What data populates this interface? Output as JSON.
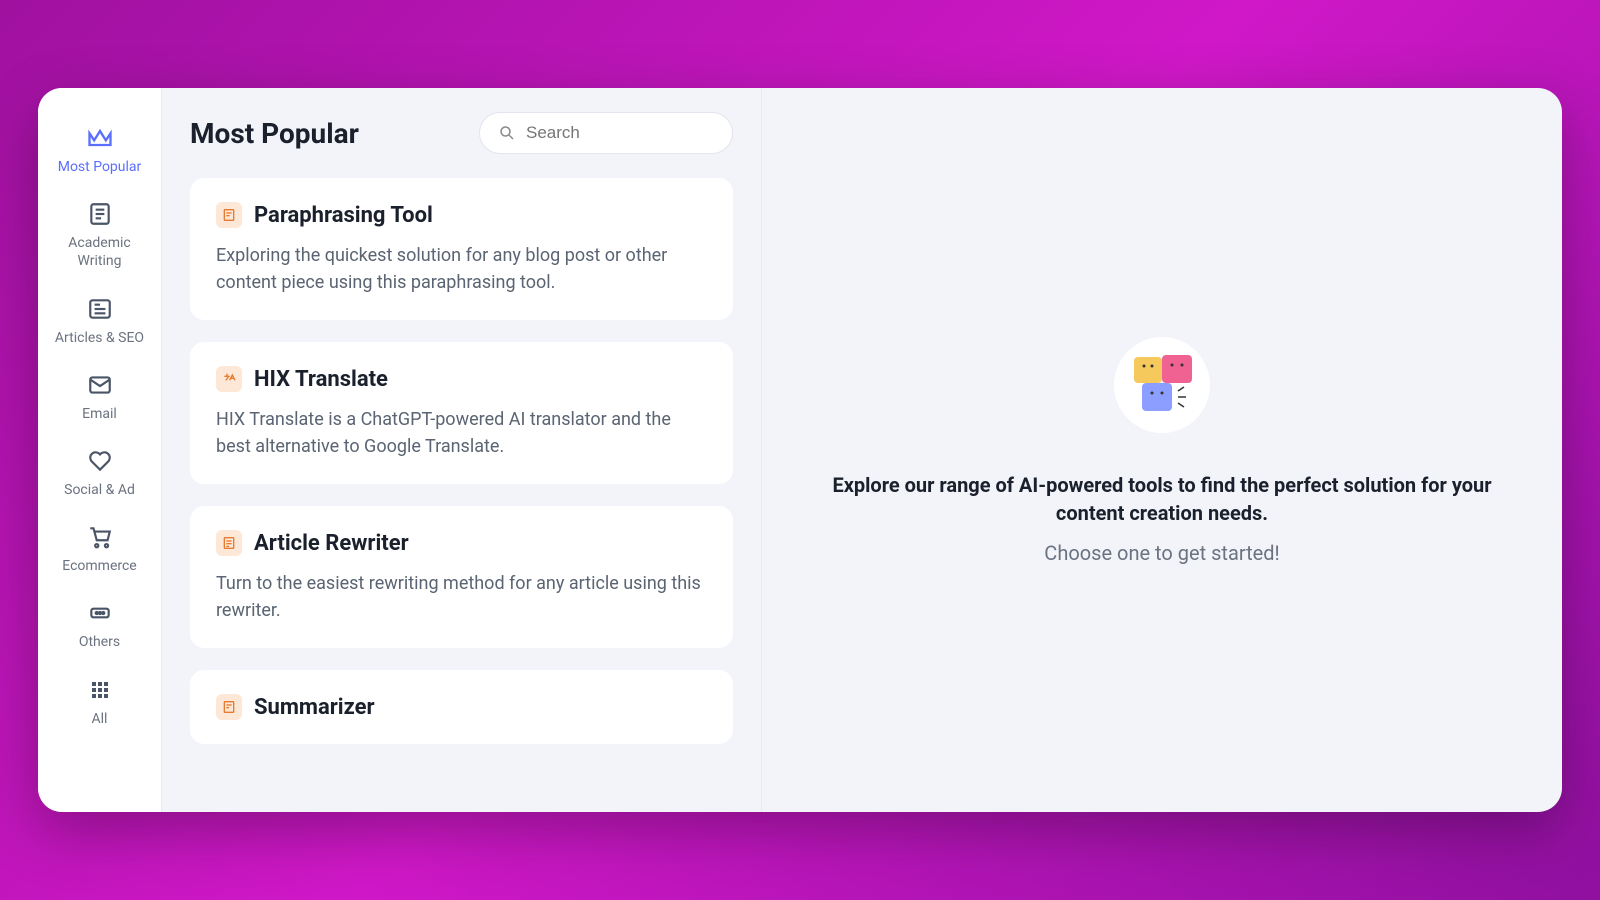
{
  "sidebar": {
    "items": [
      {
        "label": "Most Popular",
        "icon": "crown"
      },
      {
        "label": "Academic Writing",
        "icon": "doc-lines"
      },
      {
        "label": "Articles & SEO",
        "icon": "newspaper"
      },
      {
        "label": "Email",
        "icon": "mail"
      },
      {
        "label": "Social & Ad",
        "icon": "heart"
      },
      {
        "label": "Ecommerce",
        "icon": "cart"
      },
      {
        "label": "Others",
        "icon": "more"
      },
      {
        "label": "All",
        "icon": "grid"
      }
    ]
  },
  "header": {
    "title": "Most Popular",
    "search_placeholder": "Search"
  },
  "tools": [
    {
      "title": "Paraphrasing Tool",
      "description": "Exploring the quickest solution for any blog post or other content piece using this paraphrasing tool.",
      "icon": "paraphrase"
    },
    {
      "title": "HIX Translate",
      "description": "HIX Translate is a ChatGPT-powered AI translator and the best alternative to Google Translate.",
      "icon": "translate"
    },
    {
      "title": "Article Rewriter",
      "description": "Turn to the easiest rewriting method for any article using this rewriter.",
      "icon": "rewrite"
    },
    {
      "title": "Summarizer",
      "description": "",
      "icon": "summarize"
    }
  ],
  "detail": {
    "heading": "Explore our range of AI-powered tools to find the perfect solution for your content creation needs.",
    "subheading": "Choose one to get started!"
  }
}
